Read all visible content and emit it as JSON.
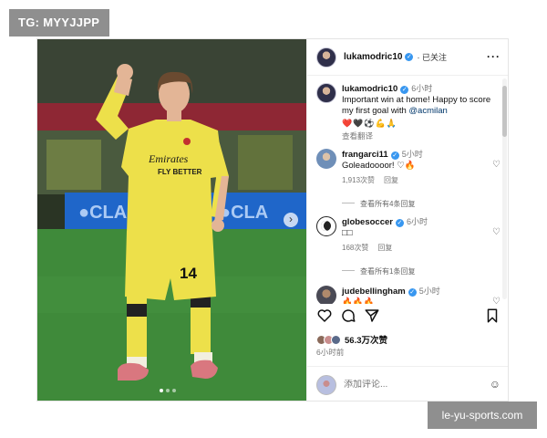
{
  "watermarks": {
    "top_left": "TG: MYYJJPP",
    "bottom_right": "le-yu-sports.com"
  },
  "photo": {
    "jersey_sponsor": "Emirates FLY BETTER",
    "jersey_number": "14",
    "carousel_dots": 3,
    "active_dot": 0,
    "next_icon": "chevron-right-icon"
  },
  "header": {
    "username": "lukamodric10",
    "follow_label": "· 已关注",
    "more_label": "···"
  },
  "caption": {
    "username": "lukamodric10",
    "time": "6小时",
    "text_before_mention": "Important win at home! Happy to score my first goal with ",
    "mention": "@acmilan",
    "emojis": "❤️🖤⚽💪🙏",
    "translate_label": "查看翻译"
  },
  "comments": [
    {
      "username": "frangarci11",
      "time": "5小时",
      "text": "Goleadoooor! ♡🔥",
      "likes": "1,913次赞",
      "reply_label": "回复",
      "view_replies": "查看所有4条回复"
    },
    {
      "username": "globesoccer",
      "time": "6小时",
      "text": "□□",
      "likes": "168次赞",
      "reply_label": "回复",
      "view_replies": "查看所有1条回复"
    },
    {
      "username": "judebellingham",
      "time": "5小时",
      "text": "🔥🔥🔥"
    }
  ],
  "actions": {
    "like_icon": "heart-icon",
    "comment_icon": "comment-icon",
    "share_icon": "send-icon",
    "save_icon": "bookmark-icon"
  },
  "likes_text": "56.3万次赞",
  "posted_time": "6小时前",
  "add_comment": {
    "placeholder": "添加评论...",
    "emoji_icon": "smiley-icon"
  },
  "colors": {
    "verified": "#3897f0",
    "kit_yellow": "#ede04a",
    "pitch_green": "#3f8a3a",
    "mention_blue": "#00376b"
  }
}
